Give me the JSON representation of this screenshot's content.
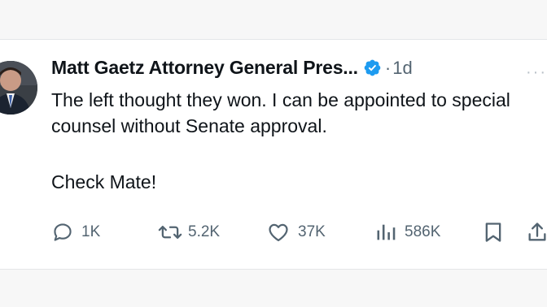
{
  "tweet": {
    "author_name": "Matt Gaetz Attorney General Pres...",
    "separator": "·",
    "time": "1d",
    "text_lines": [
      "The left thought they won. I can be appointed to special counsel without Senate approval.",
      "Check Mate!"
    ]
  },
  "actions": {
    "replies": "1K",
    "reposts": "5.2K",
    "likes": "37K",
    "views": "586K"
  },
  "colors": {
    "verified_badge": "#1d9bf0",
    "muted_text": "#536471",
    "primary_text": "#0f1419"
  },
  "icons": [
    "verified-badge-icon",
    "more-icon",
    "reply-icon",
    "repost-icon",
    "like-icon",
    "views-icon",
    "bookmark-icon",
    "share-icon"
  ]
}
